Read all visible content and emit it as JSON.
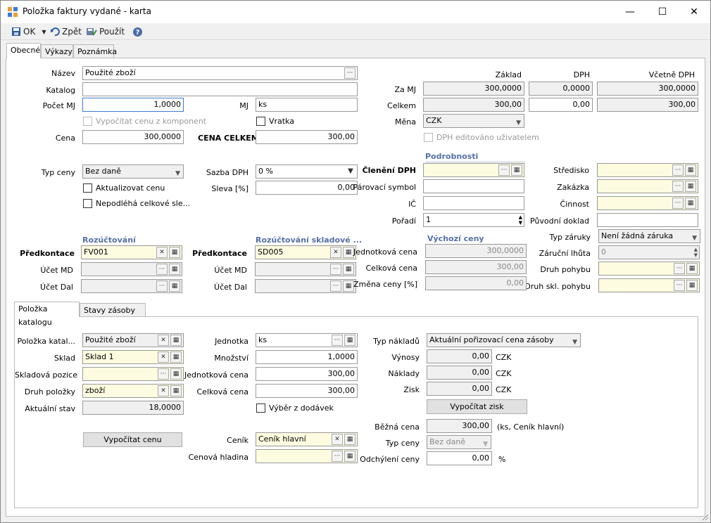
{
  "window": {
    "title": "Položka faktury vydané - karta",
    "minimize": "—",
    "maximize": "☐",
    "close": "✕"
  },
  "toolbar": {
    "ok": "OK",
    "back": "Zpět",
    "apply": "Použít"
  },
  "tabs": [
    "Obecné",
    "Výkazy",
    "Poznámka"
  ],
  "general": {
    "nazev_label": "Název",
    "nazev": "Použité zboží",
    "katalog_label": "Katalog",
    "katalog": "",
    "pocet_label": "Počet MJ",
    "pocet": "1,0000",
    "mj_label": "MJ",
    "mj": "ks",
    "vypocitat_label": "Vypočítat cenu z komponent",
    "vratka_label": "Vratka",
    "cena_label": "Cena",
    "cena": "300,0000",
    "cena_celkem_label": "CENA CELKEM",
    "cena_celkem": "300,00",
    "typ_ceny_label": "Typ ceny",
    "typ_ceny": "Bez daně",
    "sazba_label": "Sazba DPH",
    "sazba": "0 %",
    "aktualizovat_label": "Aktualizovat cenu",
    "sleva_label": "Sleva [%]",
    "sleva": "0,00",
    "nepodleha_label": "Nepodléhá celkové sle..."
  },
  "summary": {
    "col_zaklad": "Základ",
    "col_dph": "DPH",
    "col_vcetne": "Včetně DPH",
    "zamj_label": "Za MJ",
    "zamj_zaklad": "300,0000",
    "zamj_dph": "0,0000",
    "zamj_vcetne": "300,0000",
    "celkem_label": "Celkem",
    "celkem_zaklad": "300,00",
    "celkem_dph": "0,00",
    "celkem_vcetne": "300,00",
    "mena_label": "Měna",
    "mena": "CZK",
    "dph_edit_label": "DPH editováno uživatelem"
  },
  "details": {
    "header": "Podrobnosti",
    "cleneni_label": "Členění DPH",
    "cleneni": "",
    "parovaci_label": "Párovací symbol",
    "parovaci": "",
    "ic_label": "IČ",
    "ic": "",
    "poradi_label": "Pořadí",
    "poradi": "1",
    "stredisko_label": "Středisko",
    "zakazka_label": "Zakázka",
    "cinnost_label": "Činnost",
    "puvodni_label": "Původní doklad",
    "typ_zaruky_label": "Typ záruky",
    "typ_zaruky": "Není žádná záruka",
    "zarucni_label": "Záruční lhůta",
    "zarucni": "0",
    "druh_pohybu_label": "Druh pohybu",
    "druh_skl_label": "Druh skl. pohybu"
  },
  "accounting": {
    "header1": "Rozúčtování",
    "header2": "Rozúčtování skladové ...",
    "predkontace_label": "Předkontace",
    "predkontace1": "FV001",
    "predkontace2": "SD005",
    "md_label": "Účet MD",
    "dal_label": "Účet Dal"
  },
  "default_prices": {
    "header": "Výchozí ceny",
    "jednotkova_label": "Jednotková cena",
    "jednotkova": "300,0000",
    "celkova_label": "Celková cena",
    "celkova": "300,00",
    "zmena_label": "Změna ceny [%]",
    "zmena": "0,00"
  },
  "subtabs": [
    "Položka katalogu",
    "Stavy zásoby"
  ],
  "catalog": {
    "polozka_label": "Položka katal...",
    "polozka": "Použité zboží",
    "sklad_label": "Sklad",
    "sklad": "Sklad 1",
    "pozice_label": "Skladová pozice",
    "pozice": "",
    "druh_label": "Druh položky",
    "druh": "zboží",
    "stav_label": "Aktuální stav",
    "stav": "18,0000",
    "vypocitat_cenu_btn": "Vypočítat cenu",
    "jednotka_label": "Jednotka",
    "jednotka": "ks",
    "mnozstvi_label": "Množství",
    "mnozstvi": "1,0000",
    "jedn_cena_label": "Jednotková cena",
    "jedn_cena": "300,00",
    "celk_cena_label": "Celková cena",
    "celk_cena": "300,00",
    "vyber_label": "Výběr z dodávek",
    "cenik_label": "Ceník",
    "cenik": "Ceník hlavní",
    "hladina_label": "Cenová hladina",
    "hladina": "",
    "typ_nakladu_label": "Typ nákladů",
    "typ_nakladu": "Aktuální pořizovací cena zásoby",
    "vynosy_label": "Výnosy",
    "vynosy": "0,00",
    "naklady_label": "Náklady",
    "naklady": "0,00",
    "zisk_label": "Zisk",
    "zisk": "0,00",
    "currency": "CZK",
    "vypocitat_zisk_btn": "Vypočítat zisk",
    "bezna_label": "Běžná cena",
    "bezna": "300,00",
    "bezna_note": "(ks, Ceník hlavní)",
    "typ_ceny_label": "Typ ceny",
    "typ_ceny": "Bez daně",
    "odchyleni_label": "Odchýlení ceny",
    "odchyleni": "0,00",
    "percent": "%"
  }
}
